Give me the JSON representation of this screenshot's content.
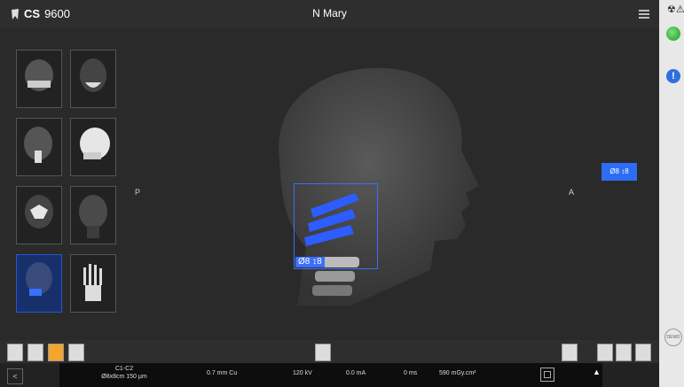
{
  "header": {
    "brand": "CS",
    "model": "9600",
    "patient": "N Mary"
  },
  "orientation": {
    "left": "P",
    "right": "A"
  },
  "fov": {
    "label": "Ø8 ↕8",
    "button_label": "Ø8 ↕8"
  },
  "status": {
    "warning_glyphs": "☢⚠",
    "info": "!"
  },
  "demo_label": "DEMO",
  "acquisition": {
    "region": "C1-C2",
    "fov_detail": "Ø8x8cm 150 μm",
    "filter": "0.7 mm Cu",
    "kv": "120 kV",
    "ma": "0.0 mA",
    "ms": "0 ms",
    "dose": "590 mGy.cm²"
  },
  "nav": {
    "prev": "<",
    "expand": "▲"
  },
  "colors": {
    "accent": "#2d6cf5",
    "selected": "#f4a52a",
    "status_ok": "#1d9a1d"
  },
  "thumbnails": [
    "panoramic",
    "frontal-teeth",
    "lateral-head",
    "skull-lateral",
    "sinus-frontal",
    "back-head",
    "cervical-spine",
    "hand"
  ]
}
